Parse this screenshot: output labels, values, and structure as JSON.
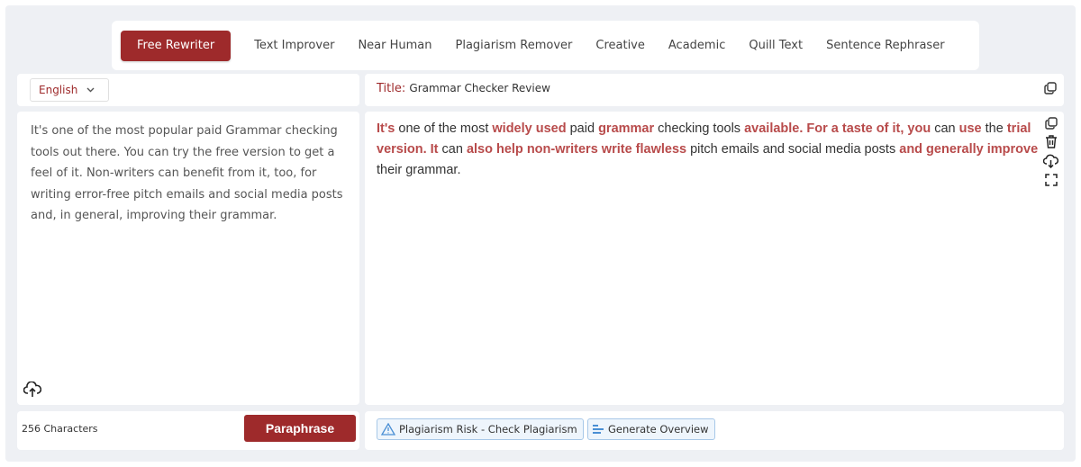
{
  "tabs": [
    "Free Rewriter",
    "Text Improver",
    "Near Human",
    "Plagiarism Remover",
    "Creative",
    "Academic",
    "Quill Text",
    "Sentence Rephraser"
  ],
  "active_tab": "Free Rewriter",
  "language": {
    "selected": "English",
    "icon": "chevron-down-icon"
  },
  "title": {
    "label": "Title:",
    "value": "Grammar Checker Review"
  },
  "input": {
    "text": "It's one of the most popular paid Grammar checking tools out there. You can try the free version to get a feel of it. Non-writers can benefit from it, too, for writing error-free pitch emails and social media posts and, in general, improving their grammar."
  },
  "output": {
    "segments": [
      {
        "t": "It's",
        "h": true
      },
      {
        "t": " one of the most ",
        "h": false
      },
      {
        "t": "widely used",
        "h": true
      },
      {
        "t": " paid ",
        "h": false
      },
      {
        "t": "grammar",
        "h": true
      },
      {
        "t": " checking tools ",
        "h": false
      },
      {
        "t": "available. For a taste of it, you",
        "h": true
      },
      {
        "t": " can ",
        "h": false
      },
      {
        "t": "use",
        "h": true
      },
      {
        "t": " the ",
        "h": false
      },
      {
        "t": "trial version. It",
        "h": true
      },
      {
        "t": " can ",
        "h": false
      },
      {
        "t": "also help non-writers write flawless",
        "h": true
      },
      {
        "t": " pitch emails and social media posts ",
        "h": false
      },
      {
        "t": "and generally improve",
        "h": true
      },
      {
        "t": " their grammar.",
        "h": false
      }
    ]
  },
  "footer": {
    "char_count": "256 Characters",
    "paraphrase_label": "Paraphrase",
    "plagiarism_label": "Plagiarism Risk - Check Plagiarism",
    "overview_label": "Generate Overview"
  },
  "colors": {
    "accent": "#9e2a2b",
    "highlight": "#b84b4b",
    "background": "#eef0f4"
  },
  "icons": [
    "copy-icon",
    "trash-icon",
    "download-icon",
    "expand-icon",
    "upload-icon",
    "warning-icon",
    "overview-icon"
  ]
}
